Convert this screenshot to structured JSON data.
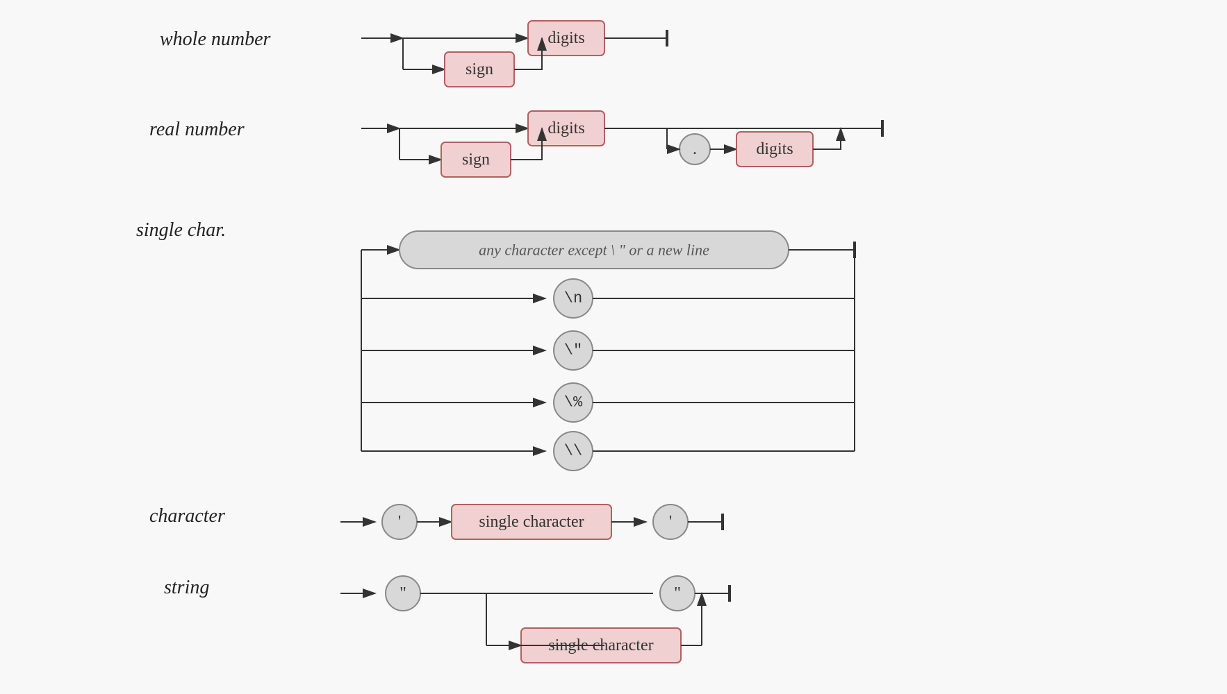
{
  "diagrams": {
    "whole_number": {
      "label": "whole number",
      "nodes": {
        "digits1": "digits",
        "sign": "sign"
      }
    },
    "real_number": {
      "label": "real number",
      "nodes": {
        "digits1": "digits",
        "sign": "sign",
        "dot": ".",
        "digits2": "digits"
      }
    },
    "single_char": {
      "label": "single char.",
      "pill": "any character except \\ \" or a new line",
      "escapes": [
        "\\n",
        "\\\"",
        "\\%",
        "\\\\"
      ]
    },
    "character": {
      "label": "character",
      "nodes": {
        "quote1": "'",
        "single_char": "single character",
        "quote2": "'"
      }
    },
    "string": {
      "label": "string",
      "nodes": {
        "dquote1": "\"",
        "single_char": "single character",
        "dquote2": "\""
      }
    }
  }
}
